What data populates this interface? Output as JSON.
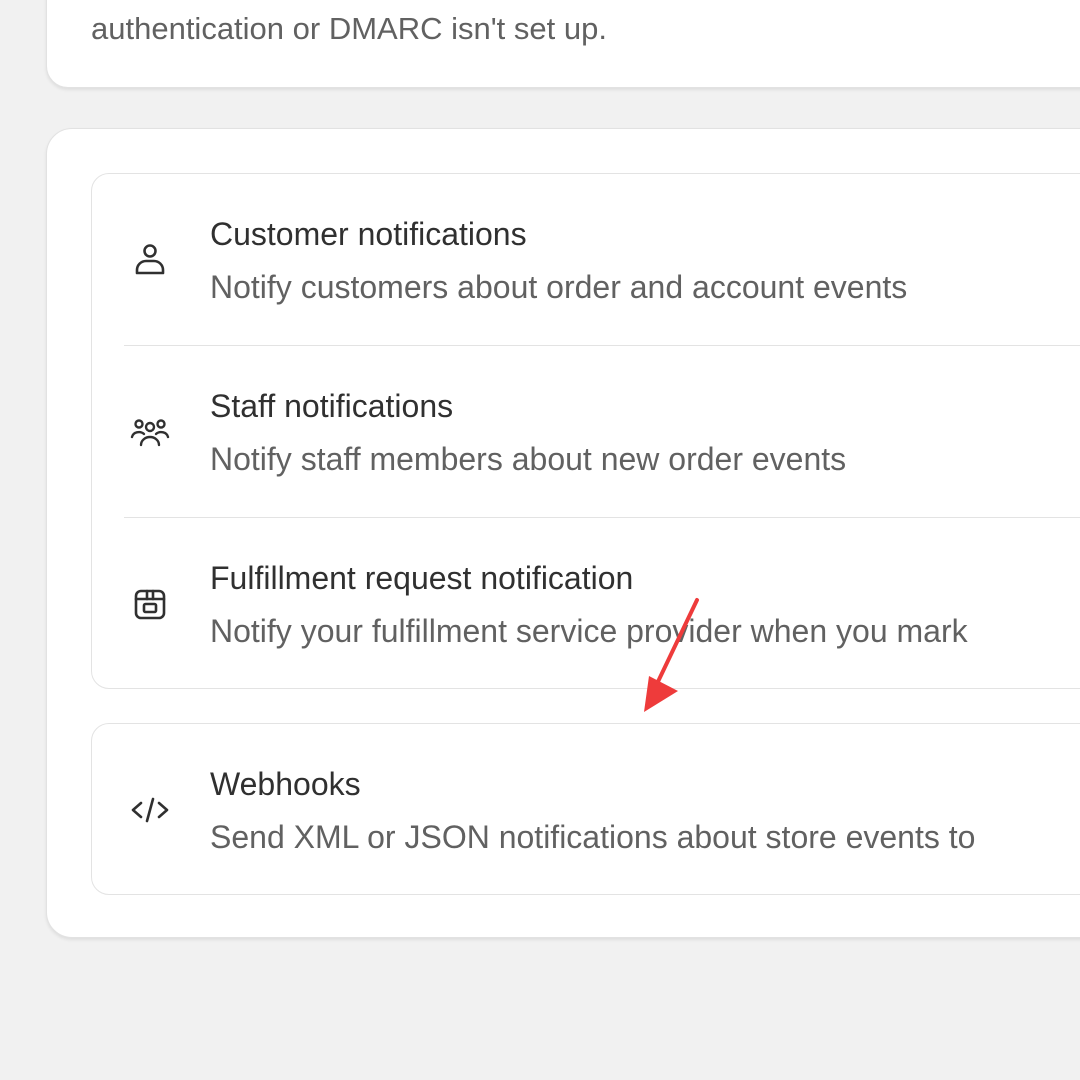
{
  "banner": {
    "text": "authentication or DMARC isn't set up."
  },
  "notifications": {
    "rows": [
      {
        "icon": "person-icon",
        "title": "Customer notifications",
        "description": "Notify customers about order and account events"
      },
      {
        "icon": "people-icon",
        "title": "Staff notifications",
        "description": "Notify staff members about new order events"
      },
      {
        "icon": "package-icon",
        "title": "Fulfillment request notification",
        "description": "Notify your fulfillment service provider when you mark"
      }
    ],
    "webhooks": {
      "icon": "code-icon",
      "title": "Webhooks",
      "description": "Send XML or JSON notifications about store events to"
    }
  },
  "annotation": {
    "arrow_color": "#ee3b3b"
  }
}
